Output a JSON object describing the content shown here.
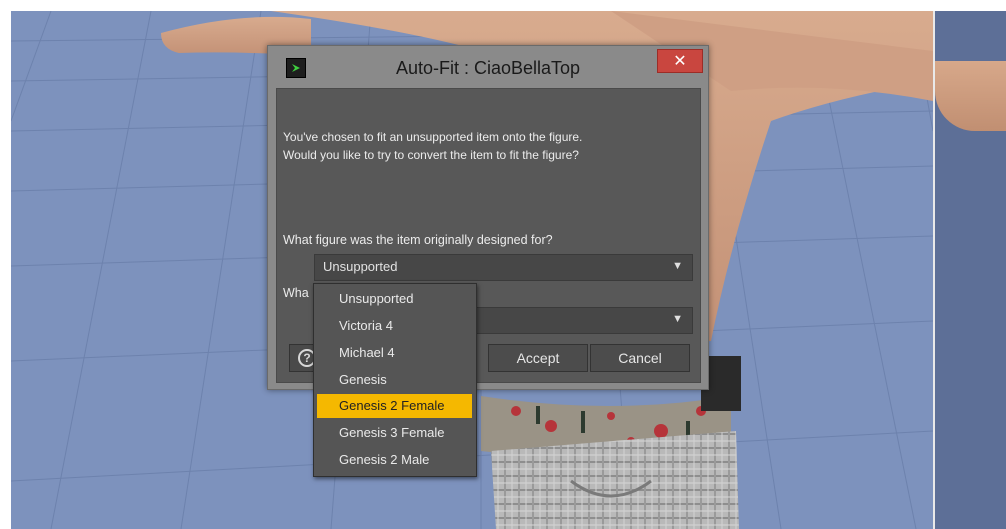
{
  "dialog": {
    "title": "Auto-Fit : CiaoBellaTop",
    "close_label": "✕",
    "message_line1": "You've chosen to fit an unsupported item onto the figure.",
    "message_line2": "Would you like to try to convert the item to fit the figure?",
    "question_original": "What figure was the item originally designed for?",
    "original_select_value": "Unsupported",
    "question_target_partial": "Wha",
    "help_label": "?",
    "accept_label": "Accept",
    "cancel_label": "Cancel",
    "arrow": "▼"
  },
  "dropdown": {
    "options": [
      "Unsupported",
      "Victoria 4",
      "Michael 4",
      "Genesis",
      "Genesis 2 Female",
      "Genesis 3 Female",
      "Genesis 2 Male"
    ],
    "selected": "Genesis 2 Female"
  },
  "colors": {
    "viewport_bg": "#7d92bd",
    "dialog_body": "#585858",
    "close_button": "#c9463f",
    "selection": "#f5b800"
  },
  "icons": {
    "app": "daz-studio-icon",
    "close": "close-icon",
    "help": "help-icon",
    "dropdown": "chevron-down-icon"
  }
}
